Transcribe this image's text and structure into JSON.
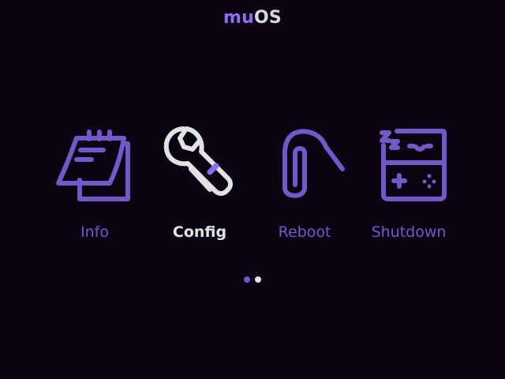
{
  "header": {
    "brand_prefix": "mu",
    "brand_suffix": "OS"
  },
  "colors": {
    "accent": "#7457c8",
    "selected": "#e2e2e4",
    "selected_accent": "#8d6bf2",
    "background": "#0a0413"
  },
  "menu": {
    "selected_index": 1,
    "items": [
      {
        "label": "Info",
        "icon": "notepad-icon"
      },
      {
        "label": "Config",
        "icon": "wrench-icon"
      },
      {
        "label": "Reboot",
        "icon": "paperclip-icon"
      },
      {
        "label": "Shutdown",
        "icon": "sleeping-handheld-icon"
      }
    ]
  },
  "pager": {
    "pages": 2,
    "current": 1
  }
}
